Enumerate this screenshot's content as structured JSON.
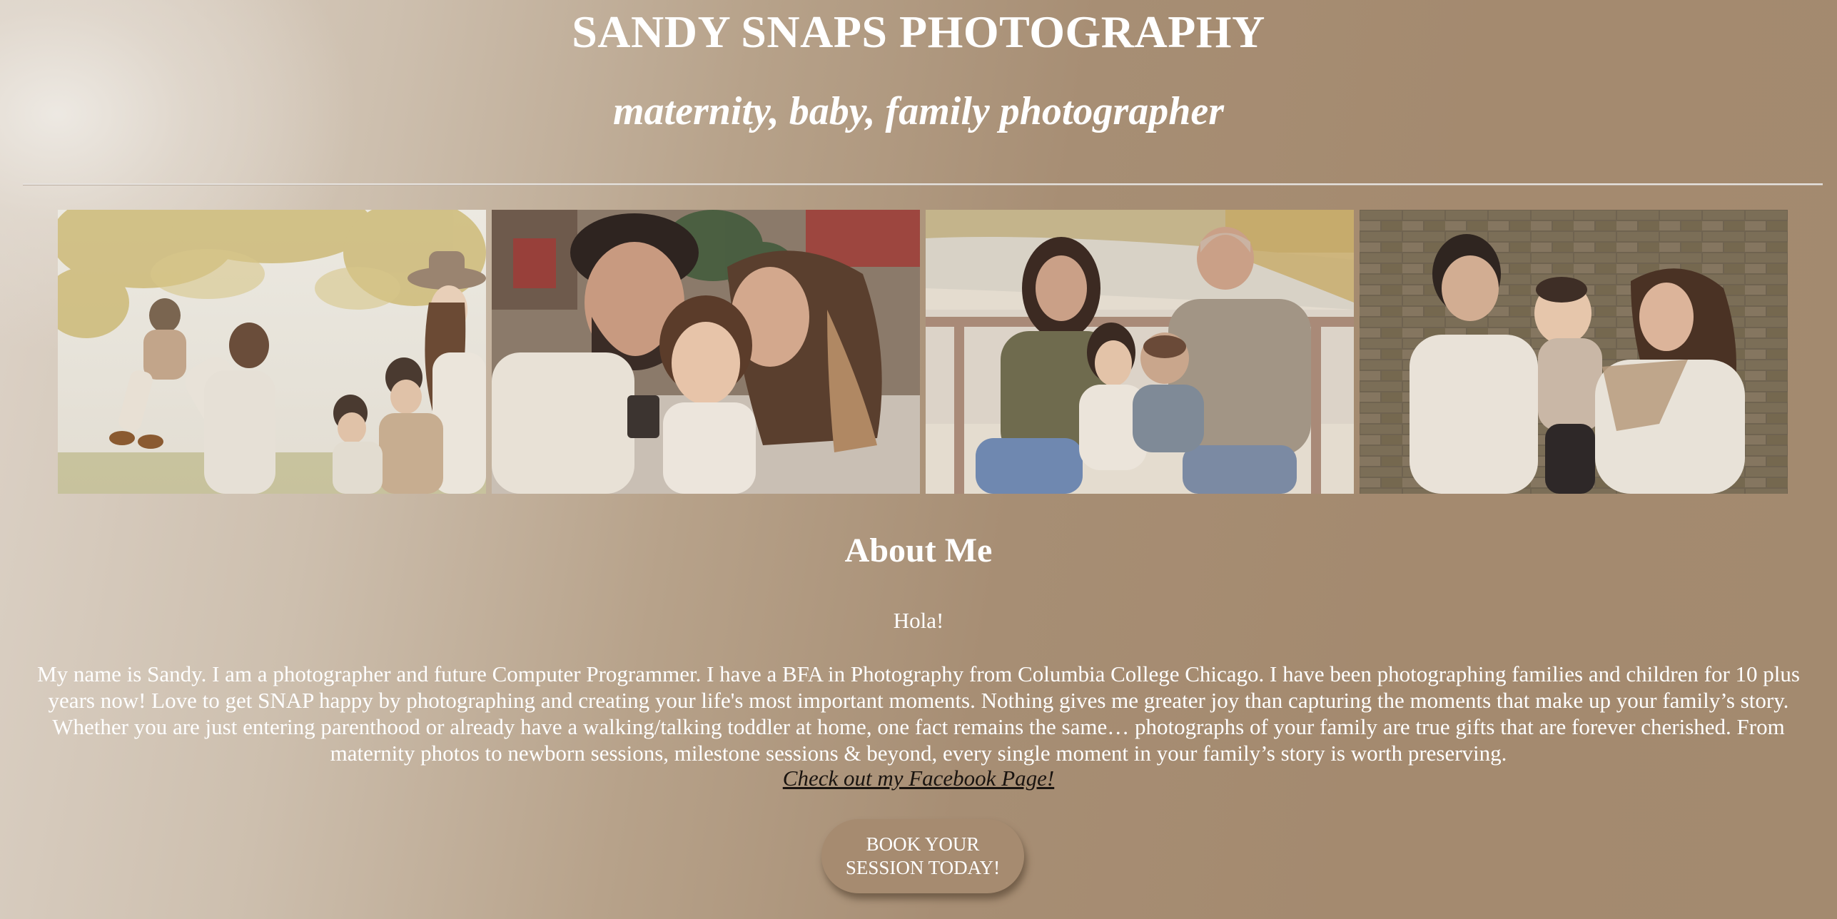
{
  "header": {
    "title": "SANDY SNAPS PHOTOGRAPHY",
    "tagline": "maternity, baby, family photographer"
  },
  "gallery": {
    "photos": [
      {
        "subject": "family-autumn-tree-photo"
      },
      {
        "subject": "parents-kissing-daughter-photo"
      },
      {
        "subject": "family-on-bench-lake-photo"
      },
      {
        "subject": "parents-with-baby-brick-wall-photo"
      }
    ]
  },
  "about": {
    "heading": "About Me",
    "greeting": "Hola!",
    "bio": "My name is Sandy. I am a photographer and future Computer Programmer. I have a BFA in Photography from Columbia College Chicago. I have been photographing families and children for 10 plus years now! Love to get SNAP happy by photographing and creating your life's most important moments. Nothing gives me greater joy than capturing the moments that make up your family’s story. Whether you are just entering parenthood or already have a walking/talking toddler at home, one fact remains the same… photographs of your family are true gifts that are forever cherished. From maternity photos to newborn sessions, milestone sessions & beyond, every single moment in your family’s story is worth preserving.",
    "facebook_link": "Check out my Facebook Page!"
  },
  "cta": {
    "label": "BOOK YOUR SESSION TODAY!"
  },
  "colors": {
    "background_light": "#e6e1da",
    "background_dark": "#a38a6f",
    "button": "#a68b70",
    "link": "#1a1410"
  }
}
